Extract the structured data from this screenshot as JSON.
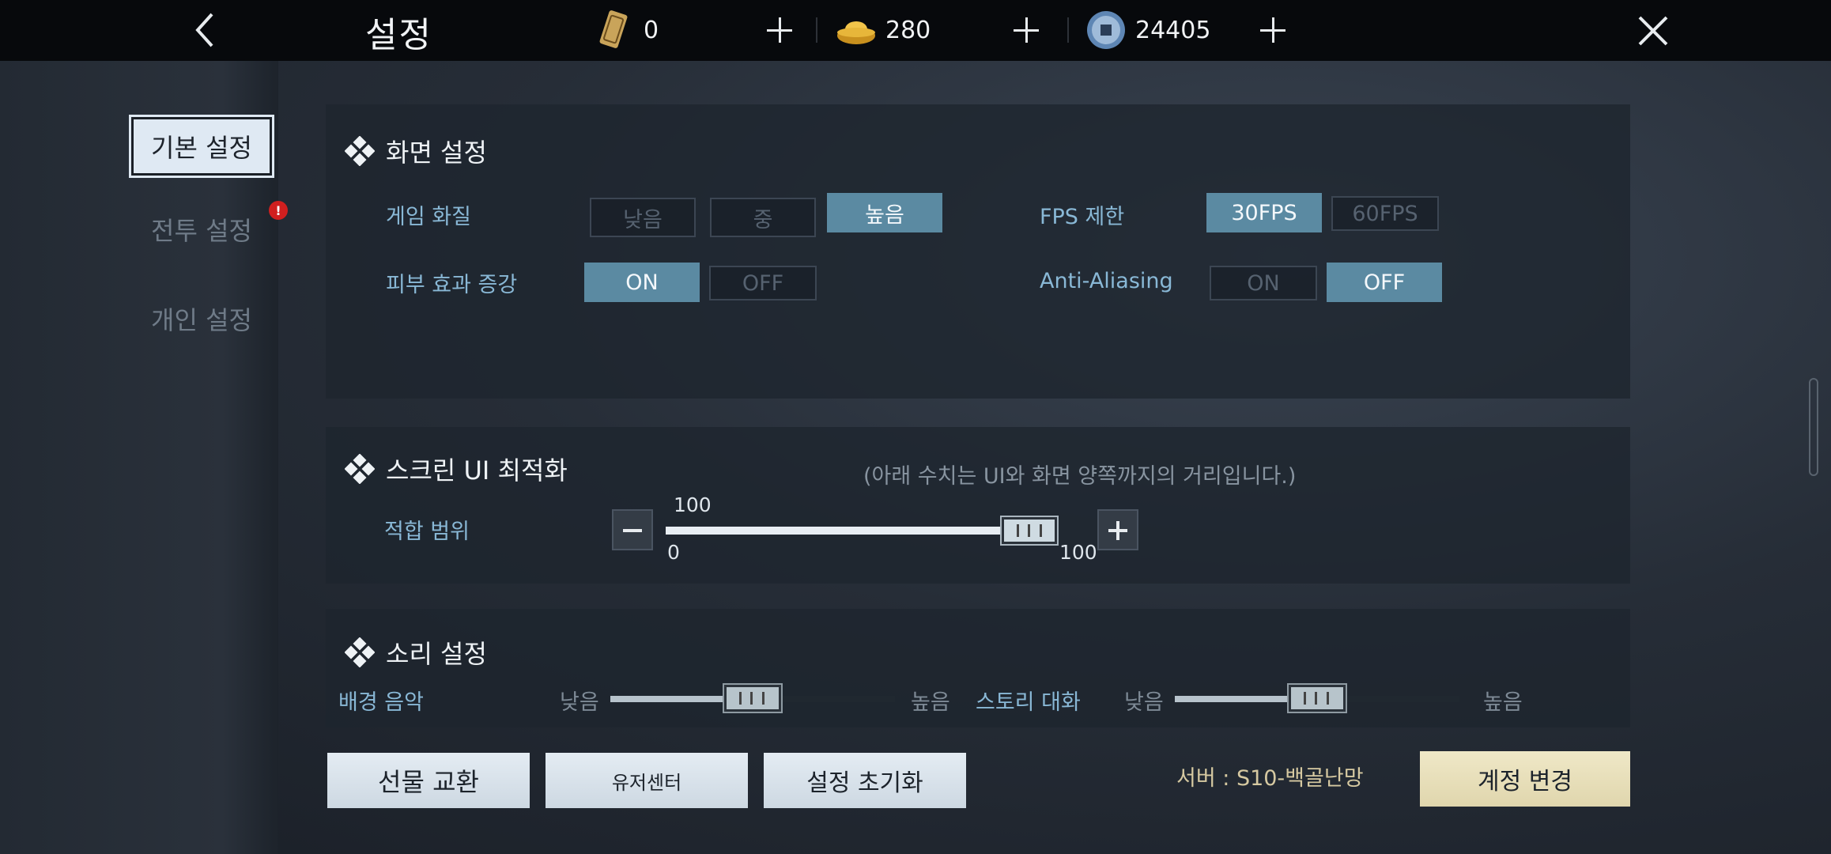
{
  "header": {
    "title": "설정",
    "currencies": [
      {
        "icon": "token-card-icon",
        "value": "0"
      },
      {
        "icon": "gold-ingot-icon",
        "value": "280"
      },
      {
        "icon": "silver-coin-icon",
        "value": "24405"
      }
    ]
  },
  "sidebar": {
    "items": [
      {
        "label": "기본 설정",
        "active": true
      },
      {
        "label": "전투 설정",
        "badge": "!"
      },
      {
        "label": "개인 설정"
      }
    ]
  },
  "display": {
    "title": "화면 설정",
    "quality_label": "게임 화질",
    "quality_options": [
      "낮음",
      "중",
      "높음"
    ],
    "quality_selected": "높음",
    "fps_label": "FPS 제한",
    "fps_options": [
      "30FPS",
      "60FPS"
    ],
    "fps_selected": "30FPS",
    "skin_label": "피부 효과 증강",
    "skin_options": [
      "ON",
      "OFF"
    ],
    "skin_selected": "ON",
    "aa_label": "Anti-Aliasing",
    "aa_options": [
      "ON",
      "OFF"
    ],
    "aa_selected": "OFF"
  },
  "screen_ui": {
    "title": "스크린 UI 최적화",
    "note": "(아래 수치는 UI와 화면 양쪽까지의 거리입니다.)",
    "fit_label": "적합 범위",
    "current_value": "100",
    "min": "0",
    "max": "100",
    "level": 1.0
  },
  "sound": {
    "title": "소리 설정",
    "bgm_label": "배경 음악",
    "story_label": "스토리 대화",
    "low": "낮음",
    "high": "높음",
    "bgm_level": 0.5,
    "story_level": 0.5
  },
  "footer": {
    "gift_exchange": "선물 교환",
    "user_center": "유저센터",
    "reset_settings": "설정 초기화",
    "server": "서버 : S10-백골난망",
    "change_account": "계정 변경"
  }
}
